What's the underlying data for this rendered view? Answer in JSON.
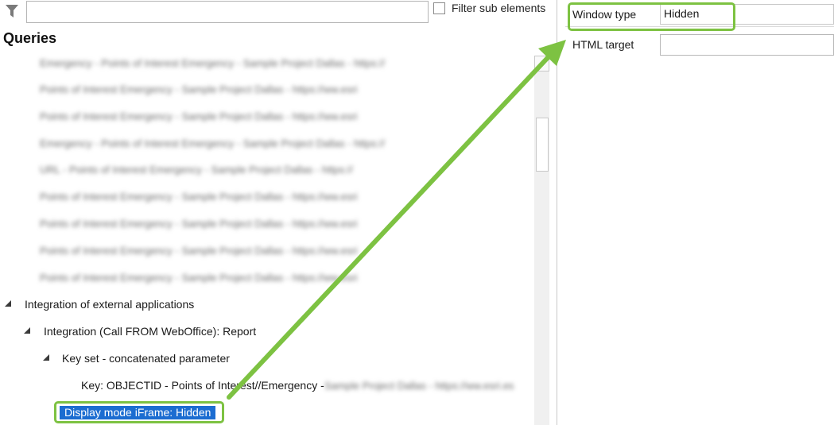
{
  "filter": {
    "value": "",
    "sub_elements_label": "Filter sub elements",
    "sub_elements_checked": false
  },
  "queries": {
    "heading": "Queries",
    "blurred_rows": [
      "Emergency - Points of Interest Emergency - Sample Project Dallas - https://",
      "Points of Interest Emergency - Sample Project Dallas - https://ww.esri",
      "Points of Interest Emergency - Sample Project Dallas - https://ww.esri",
      "Emergency - Points of Interest Emergency - Sample Project Dallas - https://",
      "URL - Points of Interest Emergency - Sample Project Dallas - https://",
      "Points of Interest Emergency - Sample Project Dallas - https://ww.esri",
      "Points of Interest Emergency - Sample Project Dallas - https://ww.esri",
      "Points of Interest Emergency - Sample Project Dallas - https://ww.esri",
      "Points of Interest Emergency - Sample Project Dallas - https://ww.esri"
    ]
  },
  "tree": {
    "integration_external": "Integration of external applications",
    "integration_call": "Integration (Call FROM WebOffice): Report",
    "key_set": "Key set - concatenated parameter",
    "key_item": "Key: OBJECTID - Points of Interest//Emergency - ",
    "key_item_blurred": "Sample Project Dallas - https://ww.esri.es",
    "selected_item": "Display mode iFrame: Hidden"
  },
  "properties": {
    "window_type_label": "Window type",
    "window_type_value": "Hidden",
    "html_target_label": "HTML target",
    "html_target_value": ""
  },
  "colors": {
    "highlight_green": "#7dc242",
    "selection_blue": "#1c6dd1"
  }
}
